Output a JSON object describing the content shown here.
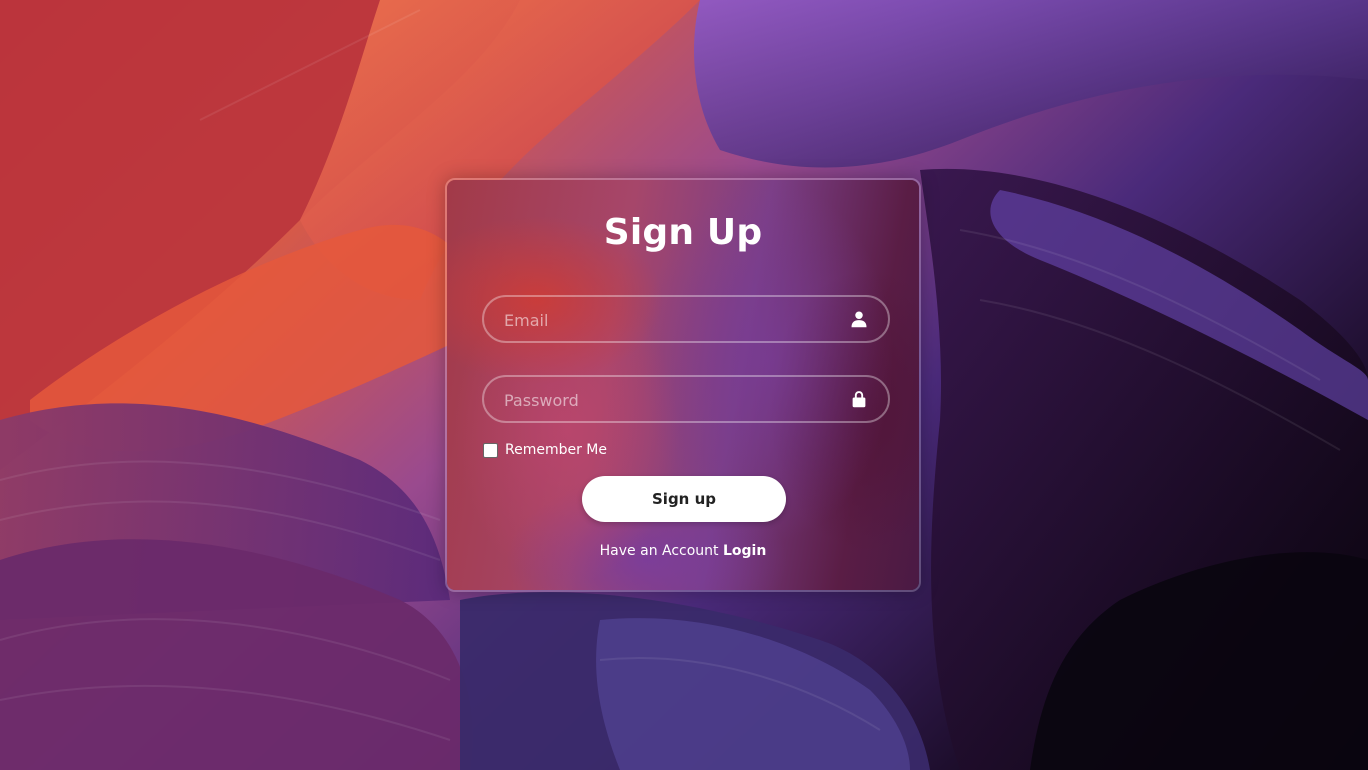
{
  "form": {
    "title": "Sign Up",
    "email": {
      "placeholder": "Email",
      "value": "",
      "icon": "user-icon"
    },
    "password": {
      "placeholder": "Password",
      "value": "",
      "icon": "lock-icon"
    },
    "remember_label": "Remember Me",
    "remember_checked": false,
    "submit_label": "Sign up",
    "account_prompt": "Have an Account",
    "login_label": "Login"
  },
  "colors": {
    "card_border": "#ffffff",
    "button_bg": "#ffffff",
    "button_text": "#222222",
    "text": "#ffffff"
  }
}
